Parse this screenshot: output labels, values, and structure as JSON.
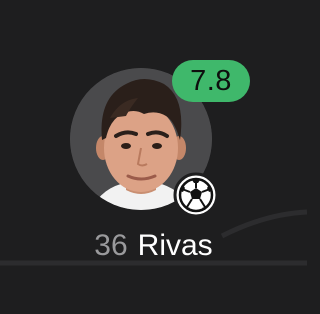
{
  "player": {
    "shirt_number": "36",
    "name": "Rivas",
    "rating": "7.8",
    "event_icon": "football-goal-icon"
  },
  "colors": {
    "background": "#1e1e1f",
    "avatar_ring": "#4a4a4c",
    "rating_badge": "#3fb86b",
    "number_text": "#9a9a9c",
    "name_text": "#ffffff",
    "pitch_line": "#2c2c2e"
  }
}
